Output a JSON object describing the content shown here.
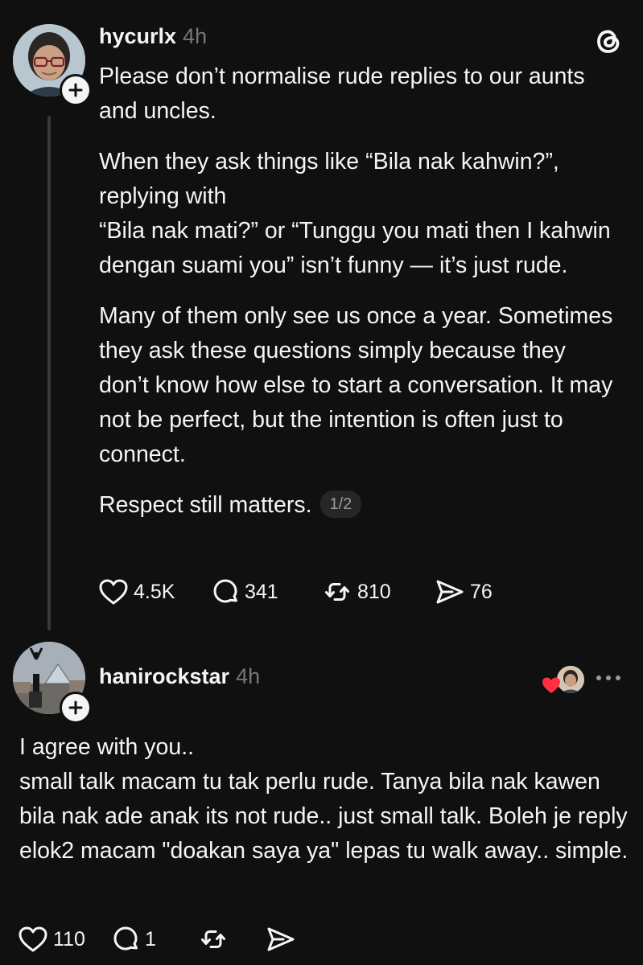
{
  "post": {
    "username": "hycurlx",
    "time": "4h",
    "paragraphs": [
      "Please don’t normalise rude replies to our aunts and uncles.",
      "When they ask things like “Bila nak kahwin?”, replying with",
      "“Bila nak mati?” or “Tunggu you mati then I kahwin dengan suami you” isn’t funny — it’s just rude.",
      "Many of them only see us once a year. Sometimes they ask these questions simply because they don’t know how else to start a conversation. It may not be perfect, but the intention is often just to connect.",
      "Respect still matters."
    ],
    "pager": "1/2",
    "likes": "4.5K",
    "comments": "341",
    "reposts": "810",
    "shares": "76"
  },
  "reply": {
    "username": "hanirockstar",
    "time": "4h",
    "lines": [
      "I agree with you..",
      "small talk macam tu tak perlu rude.  Tanya bila nak kawen bila nak ade anak its not rude.. just small talk. Boleh je reply elok2 macam \"doakan saya ya\" lepas tu walk away.. simple."
    ],
    "likes": "110",
    "comments": "1"
  },
  "colors": {
    "background": "#101010",
    "text": "#f3f5f7",
    "muted": "#777777",
    "thread_line": "#3a3a3a",
    "heart_red": "#ff3040"
  },
  "icons": {
    "logo": "threads-logo-icon",
    "like": "heart-icon",
    "comment": "comment-icon",
    "repost": "repost-icon",
    "share": "share-icon",
    "follow": "plus-icon",
    "more": "more-icon"
  }
}
